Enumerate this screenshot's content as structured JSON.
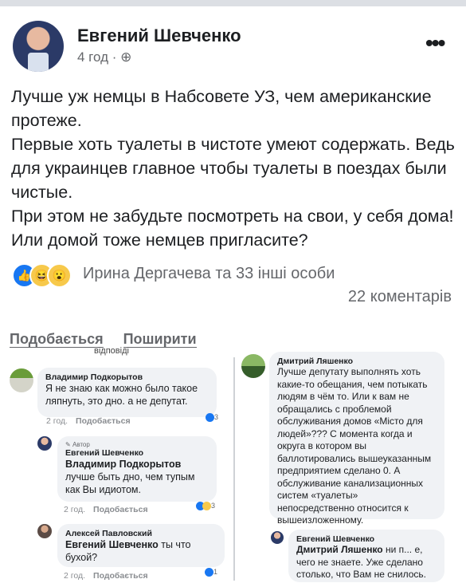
{
  "post": {
    "author": "Евгений Шевченко",
    "time": "4 год",
    "privacy_icon": "globe-icon",
    "text_lines": [
      "Лучше уж немцы в Набсовете УЗ, чем американские протеже.",
      "Первые хоть туалеты в чистоте умеют содержать. Ведь для украинцев главное чтобы туалеты в поездах были чистые.",
      "При этом не забудьте посмотреть на свои, у себя дома! Или домой тоже немцев пригласите?"
    ],
    "reactions_text": "Ирина Дергачева та 33 інші особи",
    "comments_count": "22 коментарів",
    "like_action": "Подобається",
    "share_action": "Поширити",
    "cutoff_text": "відповіді"
  },
  "comments_left": [
    {
      "name": "Владимир Подкорытов",
      "text": "Я не знаю как можно было такое ляпнуть, это дно. а не депутат.",
      "time": "2 год.",
      "like": "Подобається",
      "reactions": "3"
    },
    {
      "badge": "Автор",
      "name": "Евгений Шевченко",
      "mention": "Владимир Подкорытов",
      "text": " лучше быть дно, чем тупым как Вы идиотом.",
      "time": "2 год.",
      "like": "Подобається",
      "reactions": "3"
    },
    {
      "name": "Алексей Павловский",
      "mention": "Евгений Шевченко",
      "text": " ты что бухой?",
      "time": "2 год.",
      "like": "Подобається",
      "reactions": "1"
    }
  ],
  "comments_right": [
    {
      "name": "Дмитрий Ляшенко",
      "text": "Лучше депутату выполнять хоть какие-то обещания, чем потыкать людям в чём то. Или к вам не обращались с проблемой обслуживания домов «Місто для людей»??? С момента когда и округа в котором вы баллотировались вышеуказанным предприятием сделано 0. А обслуживание канализационных систем «туалеты» непосредственно относится к вышеизложенному."
    },
    {
      "name": "Евгений Шевченко",
      "mention": "Дмитрий Ляшенко",
      "text": " ни п... е, чего не знаете. Уже сделано столько, что Вам не снилось."
    }
  ]
}
